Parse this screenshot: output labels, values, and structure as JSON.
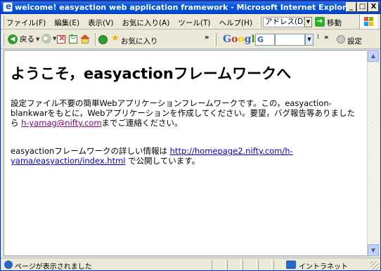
{
  "window": {
    "title": "welcome! easyaction web application framework - Microsoft Internet Explorer",
    "minimize": "_",
    "maximize": "□",
    "close": "X"
  },
  "menubar": {
    "items": [
      {
        "label": "ファイル(F)"
      },
      {
        "label": "編集(E)"
      },
      {
        "label": "表示(V)"
      },
      {
        "label": "お気に入り(A)"
      },
      {
        "label": "ツール(T)"
      },
      {
        "label": "ヘルプ(H)"
      }
    ],
    "address_label": "アドレス(D)",
    "go_label": "移動"
  },
  "toolbar": {
    "back_label": "戻る",
    "favorites_label": "お気に入り",
    "google_logo": [
      "G",
      "o",
      "o",
      "g",
      "l",
      "e"
    ],
    "google_button": "G",
    "settings_label": "設定"
  },
  "page": {
    "heading": "ようこそ，easyactionフレームワークへ",
    "para1_before": "設定ファイル不要の簡単Webアプリケーションフレームワークです。この，easyaction-blankwarをもとに，Webアプリケーションを作成してください。要望，バグ報告等ありましたら ",
    "email": "h-yamag@nifty.com",
    "para1_after": "までご連絡ください。",
    "para2_before": "easyactionフレームワークの詳しい情報は ",
    "url": "http://homepage2.nifty.com/h-yama/easyaction/index.html",
    "para2_after": " で公開しています。"
  },
  "statusbar": {
    "status_text": "ページが表示されました",
    "zone_text": "イントラネット"
  },
  "colors": {
    "titlebar": "#0058e6",
    "visited_link": "#800080",
    "link": "#0000cc"
  }
}
